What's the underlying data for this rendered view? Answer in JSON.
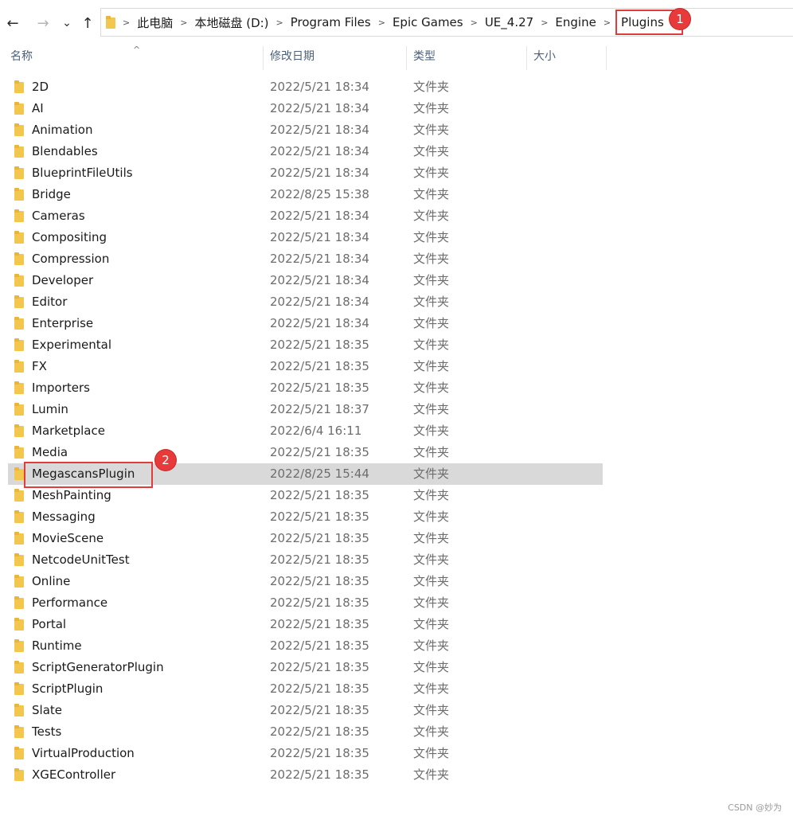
{
  "nav": {
    "back_icon": "←",
    "forward_icon": "→",
    "recent_icon": "⌄",
    "up_icon": "↑"
  },
  "breadcrumb": {
    "items": [
      "此电脑",
      "本地磁盘 (D:)",
      "Program Files",
      "Epic Games",
      "UE_4.27",
      "Engine"
    ],
    "current": "Plugins"
  },
  "annotations": {
    "badge_1": "1",
    "badge_2": "2"
  },
  "columns": {
    "name": "名称",
    "modified": "修改日期",
    "type": "类型",
    "size": "大小"
  },
  "rows": [
    {
      "name": "2D",
      "date": "2022/5/21 18:34",
      "type": "文件夹"
    },
    {
      "name": "AI",
      "date": "2022/5/21 18:34",
      "type": "文件夹"
    },
    {
      "name": "Animation",
      "date": "2022/5/21 18:34",
      "type": "文件夹"
    },
    {
      "name": "Blendables",
      "date": "2022/5/21 18:34",
      "type": "文件夹"
    },
    {
      "name": "BlueprintFileUtils",
      "date": "2022/5/21 18:34",
      "type": "文件夹"
    },
    {
      "name": "Bridge",
      "date": "2022/8/25 15:38",
      "type": "文件夹"
    },
    {
      "name": "Cameras",
      "date": "2022/5/21 18:34",
      "type": "文件夹"
    },
    {
      "name": "Compositing",
      "date": "2022/5/21 18:34",
      "type": "文件夹"
    },
    {
      "name": "Compression",
      "date": "2022/5/21 18:34",
      "type": "文件夹"
    },
    {
      "name": "Developer",
      "date": "2022/5/21 18:34",
      "type": "文件夹"
    },
    {
      "name": "Editor",
      "date": "2022/5/21 18:34",
      "type": "文件夹"
    },
    {
      "name": "Enterprise",
      "date": "2022/5/21 18:34",
      "type": "文件夹"
    },
    {
      "name": "Experimental",
      "date": "2022/5/21 18:35",
      "type": "文件夹"
    },
    {
      "name": "FX",
      "date": "2022/5/21 18:35",
      "type": "文件夹"
    },
    {
      "name": "Importers",
      "date": "2022/5/21 18:35",
      "type": "文件夹"
    },
    {
      "name": "Lumin",
      "date": "2022/5/21 18:37",
      "type": "文件夹"
    },
    {
      "name": "Marketplace",
      "date": "2022/6/4 16:11",
      "type": "文件夹"
    },
    {
      "name": "Media",
      "date": "2022/5/21 18:35",
      "type": "文件夹"
    },
    {
      "name": "MegascansPlugin",
      "date": "2022/8/25 15:44",
      "type": "文件夹",
      "selected": true
    },
    {
      "name": "MeshPainting",
      "date": "2022/5/21 18:35",
      "type": "文件夹"
    },
    {
      "name": "Messaging",
      "date": "2022/5/21 18:35",
      "type": "文件夹"
    },
    {
      "name": "MovieScene",
      "date": "2022/5/21 18:35",
      "type": "文件夹"
    },
    {
      "name": "NetcodeUnitTest",
      "date": "2022/5/21 18:35",
      "type": "文件夹"
    },
    {
      "name": "Online",
      "date": "2022/5/21 18:35",
      "type": "文件夹"
    },
    {
      "name": "Performance",
      "date": "2022/5/21 18:35",
      "type": "文件夹"
    },
    {
      "name": "Portal",
      "date": "2022/5/21 18:35",
      "type": "文件夹"
    },
    {
      "name": "Runtime",
      "date": "2022/5/21 18:35",
      "type": "文件夹"
    },
    {
      "name": "ScriptGeneratorPlugin",
      "date": "2022/5/21 18:35",
      "type": "文件夹"
    },
    {
      "name": "ScriptPlugin",
      "date": "2022/5/21 18:35",
      "type": "文件夹"
    },
    {
      "name": "Slate",
      "date": "2022/5/21 18:35",
      "type": "文件夹"
    },
    {
      "name": "Tests",
      "date": "2022/5/21 18:35",
      "type": "文件夹"
    },
    {
      "name": "VirtualProduction",
      "date": "2022/5/21 18:35",
      "type": "文件夹"
    },
    {
      "name": "XGEController",
      "date": "2022/5/21 18:35",
      "type": "文件夹"
    }
  ],
  "watermark": "CSDN @妙为",
  "colors": {
    "annotation_red": "#e23b3b",
    "selected_row": "#d9d9d9",
    "folder_yellow": "#f3c64d"
  }
}
